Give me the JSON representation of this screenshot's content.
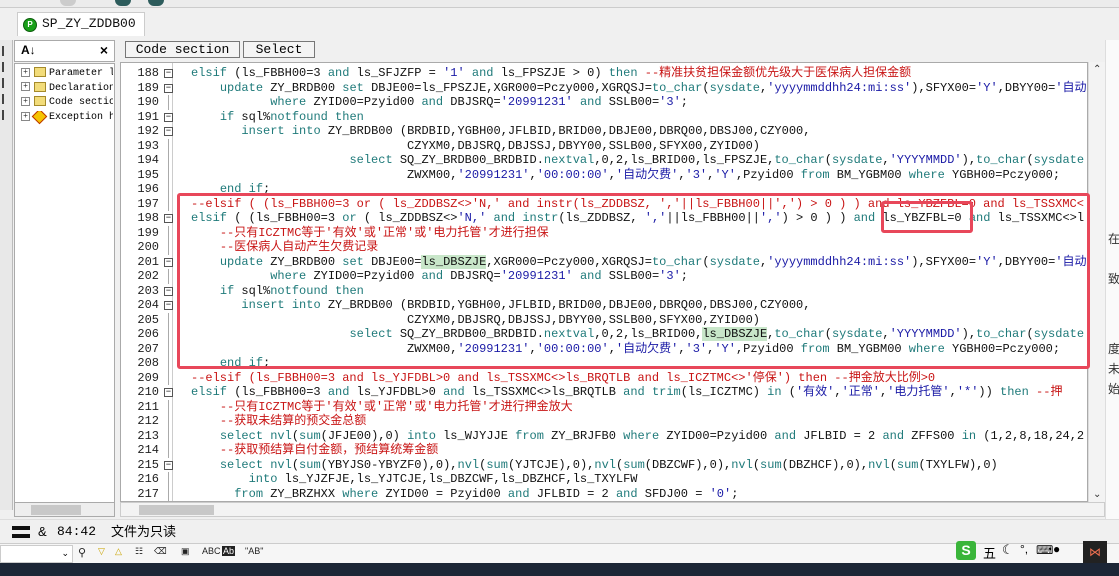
{
  "tab": {
    "title": "SP_ZY_ZDDB00",
    "icon_letter": "P"
  },
  "tree": {
    "sort_icon": "A-Z",
    "close_icon": "×",
    "items": [
      {
        "label": "Parameter l",
        "icon": "folder"
      },
      {
        "label": "Declaration",
        "icon": "folder"
      },
      {
        "label": "Code sectio",
        "icon": "folder"
      },
      {
        "label": "Exception h",
        "icon": "exception"
      }
    ]
  },
  "code_header": {
    "code_section": "Code section",
    "select": "Select"
  },
  "code": {
    "highlight_word": "ls_DBSZJE",
    "keywords": [
      "elsif",
      "and",
      "or",
      "then",
      "update",
      "set",
      "where",
      "if",
      "insert",
      "into",
      "select",
      "from",
      "end",
      "to_char",
      "sysdate",
      "nextval",
      "instr",
      "trim",
      "in",
      "nvl",
      "sum",
      "notfound"
    ],
    "lines": [
      {
        "num": "188",
        "fold": "box",
        "indent": 0,
        "text": "elsif (ls_FBBH00=3 and ls_SFJZFP = '1' and ls_FPSZJE > 0) then --精准扶贫担保金额优先级大于医保病人担保金额"
      },
      {
        "num": "189",
        "fold": "box",
        "indent": 4,
        "text": "update ZY_BRDB00 set DBJE00=ls_FPSZJE,XGR000=Pczy000,XGRQSJ=to_char(sysdate,'yyyymmddhh24:mi:ss'),SFYX00='Y',DBYY00='自动"
      },
      {
        "num": "190",
        "fold": "line",
        "indent": 11,
        "text": "where ZYID00=Pzyid00 and DBJSRQ='20991231' and SSLB00='3';"
      },
      {
        "num": "191",
        "fold": "box",
        "indent": 4,
        "text": "if sql%notfound then"
      },
      {
        "num": "192",
        "fold": "box",
        "indent": 7,
        "text": "insert into ZY_BRDB00 (BRDBID,YGBH00,JFLBID,BRID00,DBJE00,DBRQ00,DBSJ00,CZY000,"
      },
      {
        "num": "193",
        "fold": "line",
        "indent": 30,
        "text": "CZYXM0,DBJSRQ,DBJSSJ,DBYY00,SSLB00,SFYX00,ZYID00)"
      },
      {
        "num": "194",
        "fold": "line",
        "indent": 22,
        "text": "select SQ_ZY_BRDB00_BRDBID.nextval,0,2,ls_BRID00,ls_FPSZJE,to_char(sysdate,'YYYYMMDD'),to_char(sysdate"
      },
      {
        "num": "195",
        "fold": "line",
        "indent": 30,
        "text": "ZWXM00,'20991231','00:00:00','自动欠费','3','Y',Pzyid00 from BM_YGBM00 where YGBH00=Pczy000;"
      },
      {
        "num": "196",
        "fold": "line",
        "indent": 4,
        "text": "end if;"
      },
      {
        "num": "197",
        "fold": "line",
        "indent": 0,
        "text": "--elsif ( (ls_FBBH00=3 or ( ls_ZDDBSZ<>'N,' and instr(ls_ZDDBSZ, ','||ls_FBBH00||',') > 0 ) ) and ls_YBZFBL=0 and ls_TSSXMC<"
      },
      {
        "num": "198",
        "fold": "box",
        "indent": 0,
        "text": "elsif ( (ls_FBBH00=3 or ( ls_ZDDBSZ<>'N,' and instr(ls_ZDDBSZ, ','||ls_FBBH00||',') > 0 ) ) and ls_YBZFBL=0 and ls_TSSXMC<>l"
      },
      {
        "num": "199",
        "fold": "line",
        "indent": 4,
        "text": "--只有ICZTMC等于'有效'或'正常'或'电力托管'才进行担保"
      },
      {
        "num": "200",
        "fold": "line",
        "indent": 4,
        "text": "--医保病人自动产生欠费记录"
      },
      {
        "num": "201",
        "fold": "box",
        "indent": 4,
        "text": "update ZY_BRDB00 set DBJE00=ls_DBSZJE,XGR000=Pczy000,XGRQSJ=to_char(sysdate,'yyyymmddhh24:mi:ss'),SFYX00='Y',DBYY00='自动"
      },
      {
        "num": "202",
        "fold": "line",
        "indent": 11,
        "text": "where ZYID00=Pzyid00 and DBJSRQ='20991231' and SSLB00='3';"
      },
      {
        "num": "203",
        "fold": "box",
        "indent": 4,
        "text": "if sql%notfound then"
      },
      {
        "num": "204",
        "fold": "box",
        "indent": 7,
        "text": "insert into ZY_BRDB00 (BRDBID,YGBH00,JFLBID,BRID00,DBJE00,DBRQ00,DBSJ00,CZY000,"
      },
      {
        "num": "205",
        "fold": "line",
        "indent": 30,
        "text": "CZYXM0,DBJSRQ,DBJSSJ,DBYY00,SSLB00,SFYX00,ZYID00)"
      },
      {
        "num": "206",
        "fold": "line",
        "indent": 22,
        "text": "select SQ_ZY_BRDB00_BRDBID.nextval,0,2,ls_BRID00,ls_DBSZJE,to_char(sysdate,'YYYYMMDD'),to_char(sysdate"
      },
      {
        "num": "207",
        "fold": "line",
        "indent": 30,
        "text": "ZWXM00,'20991231','00:00:00','自动欠费','3','Y',Pzyid00 from BM_YGBM00 where YGBH00=Pczy000;"
      },
      {
        "num": "208",
        "fold": "line",
        "indent": 4,
        "text": "end if;"
      },
      {
        "num": "209",
        "fold": "line",
        "indent": 0,
        "text": "--elsif (ls_FBBH00=3 and ls_YJFDBL>0 and ls_TSSXMC<>ls_BRQTLB and ls_ICZTMC<>'停保') then --押金放大比例>0"
      },
      {
        "num": "210",
        "fold": "box",
        "indent": 0,
        "text": "elsif (ls_FBBH00=3 and ls_YJFDBL>0 and ls_TSSXMC<>ls_BRQTLB and trim(ls_ICZTMC) in ('有效','正常','电力托管','*')) then --押"
      },
      {
        "num": "211",
        "fold": "line",
        "indent": 4,
        "text": "--只有ICZTMC等于'有效'或'正常'或'电力托管'才进行押金放大"
      },
      {
        "num": "212",
        "fold": "line",
        "indent": 4,
        "text": "--获取未结算的预交金总额"
      },
      {
        "num": "213",
        "fold": "line",
        "indent": 4,
        "text": "select nvl(sum(JFJE00),0) into ls_WJYJJE from ZY_BRJFB0 where ZYID00=Pzyid00 and JFLBID = 2 and ZFFS00 in (1,2,8,18,24,2"
      },
      {
        "num": "214",
        "fold": "line",
        "indent": 4,
        "text": "--获取预结算自付金额，预结算统筹金额"
      },
      {
        "num": "215",
        "fold": "box",
        "indent": 4,
        "text": "select nvl(sum(YBYJS0-YBYZF0),0),nvl(sum(YJTCJE),0),nvl(sum(DBZCWF),0),nvl(sum(DBZHCF),0),nvl(sum(TXYLFW),0)"
      },
      {
        "num": "216",
        "fold": "line",
        "indent": 8,
        "text": "into ls_YJZFJE,ls_YJTCJE,ls_DBZCWF,ls_DBZHCF,ls_TXYLFW"
      },
      {
        "num": "217",
        "fold": "line",
        "indent": 6,
        "text": "from ZY_BRZHXX where ZYID00 = Pzyid00 and JFLBID = 2 and SFDJ00 = '0';"
      }
    ]
  },
  "status": {
    "symbol": "&",
    "position": "84:42",
    "message": "文件为只读"
  },
  "bottom_toolbar": {
    "abc": "ABC",
    "ab_quoted": "\"AB\""
  },
  "ime": {
    "mode": "五"
  },
  "right_panel_chars": [
    "在",
    "致",
    "度",
    "未",
    "始"
  ],
  "colors": {
    "annotation": "#e8475a",
    "keyword": "#1f7a7a",
    "comment": "#c81414",
    "string": "#1a1aa6",
    "highlight": "#c8e6c9"
  }
}
